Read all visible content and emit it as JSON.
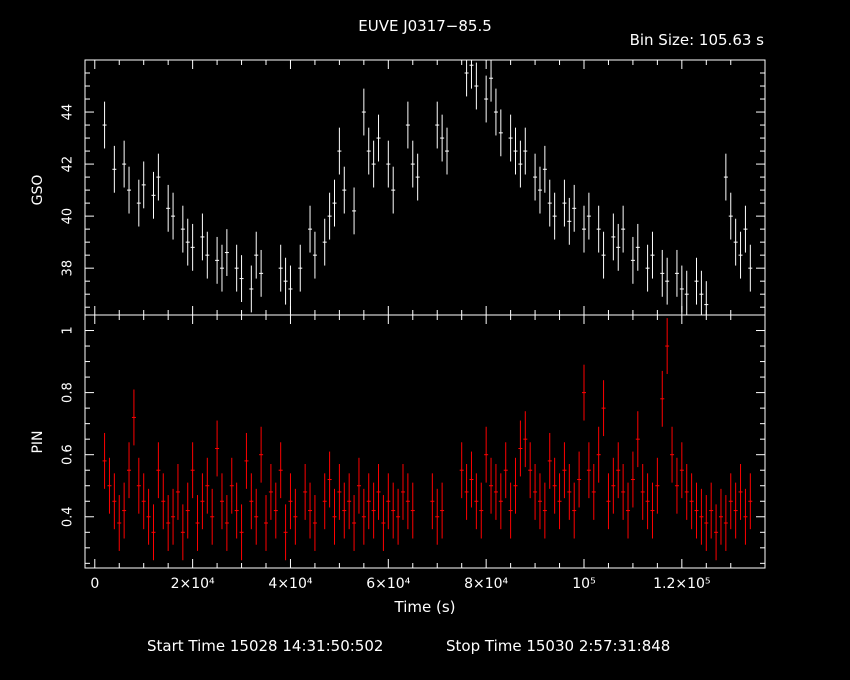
{
  "title": "EUVE J0317−85.5",
  "bin_size": "Bin Size: 105.63 s",
  "footer": {
    "start": "Start Time 15028 14:31:50:502",
    "stop": "Stop Time 15030  2:57:31:848"
  },
  "colors": {
    "background": "#000000",
    "axes": "#ffffff",
    "top_series": "#ffffff",
    "bottom_series": "#ff0000"
  },
  "chart_data": [
    {
      "type": "scatter",
      "ylabel": "GSO",
      "xlim": [
        -2000,
        137000
      ],
      "ylim": [
        36.2,
        46.0
      ],
      "yticks": [
        "38",
        "40",
        "42",
        "44"
      ],
      "series": [
        {
          "values_xy": [
            [
              2000,
              43.5
            ],
            [
              4000,
              41.8
            ],
            [
              6000,
              42.0
            ],
            [
              7000,
              41.0
            ],
            [
              9000,
              40.5
            ],
            [
              10000,
              41.2
            ],
            [
              12000,
              40.8
            ],
            [
              13000,
              41.5
            ],
            [
              15000,
              40.3
            ],
            [
              16000,
              40.0
            ],
            [
              18000,
              39.5
            ],
            [
              19000,
              39.0
            ],
            [
              20000,
              38.8
            ],
            [
              22000,
              39.2
            ],
            [
              23000,
              38.5
            ],
            [
              25000,
              38.3
            ],
            [
              26000,
              38.0
            ],
            [
              27000,
              38.6
            ],
            [
              29000,
              38.0
            ],
            [
              30000,
              37.6
            ],
            [
              32000,
              37.2
            ],
            [
              33000,
              38.5
            ],
            [
              34000,
              37.8
            ],
            [
              38000,
              38.0
            ],
            [
              39000,
              37.5
            ],
            [
              40000,
              37.2
            ],
            [
              42000,
              38.0
            ],
            [
              44000,
              39.5
            ],
            [
              45000,
              38.5
            ],
            [
              47000,
              39.0
            ],
            [
              48000,
              40.0
            ],
            [
              49000,
              40.5
            ],
            [
              50000,
              42.5
            ],
            [
              51000,
              41.0
            ],
            [
              53000,
              40.2
            ],
            [
              55000,
              44.0
            ],
            [
              56000,
              42.5
            ],
            [
              57000,
              42.0
            ],
            [
              58000,
              43.0
            ],
            [
              60000,
              42.0
            ],
            [
              61000,
              41.0
            ],
            [
              64000,
              43.5
            ],
            [
              65000,
              42.0
            ],
            [
              66000,
              41.5
            ],
            [
              70000,
              43.5
            ],
            [
              71000,
              43.0
            ],
            [
              72000,
              42.5
            ],
            [
              76000,
              45.5
            ],
            [
              77000,
              45.8
            ],
            [
              78000,
              45.0
            ],
            [
              80000,
              44.5
            ],
            [
              81000,
              45.3
            ],
            [
              82000,
              44.0
            ],
            [
              83000,
              43.2
            ],
            [
              85000,
              43.0
            ],
            [
              86000,
              42.5
            ],
            [
              87000,
              42.0
            ],
            [
              88000,
              42.5
            ],
            [
              90000,
              41.5
            ],
            [
              91000,
              41.0
            ],
            [
              92000,
              41.8
            ],
            [
              93000,
              40.5
            ],
            [
              94000,
              40.0
            ],
            [
              96000,
              40.5
            ],
            [
              97000,
              39.8
            ],
            [
              98000,
              40.3
            ],
            [
              100000,
              39.5
            ],
            [
              101000,
              40.0
            ],
            [
              103000,
              39.5
            ],
            [
              104000,
              38.5
            ],
            [
              106000,
              39.2
            ],
            [
              107000,
              38.8
            ],
            [
              108000,
              39.5
            ],
            [
              110000,
              38.3
            ],
            [
              111000,
              38.8
            ],
            [
              113000,
              38.0
            ],
            [
              114000,
              38.5
            ],
            [
              116000,
              37.8
            ],
            [
              117000,
              37.5
            ],
            [
              119000,
              37.8
            ],
            [
              120000,
              37.2
            ],
            [
              121000,
              37.0
            ],
            [
              123000,
              37.5
            ],
            [
              124000,
              37.0
            ],
            [
              125000,
              36.6
            ],
            [
              129000,
              41.5
            ],
            [
              130000,
              40.0
            ],
            [
              131000,
              39.0
            ],
            [
              132000,
              38.5
            ],
            [
              133000,
              39.5
            ],
            [
              134000,
              38.0
            ]
          ]
        }
      ]
    },
    {
      "type": "scatter",
      "ylabel": "PIN",
      "xlabel": "Time (s)",
      "xlim": [
        -2000,
        137000
      ],
      "ylim": [
        0.235,
        1.05
      ],
      "yticks": [
        "0.4",
        "0.6",
        "0.8",
        "1"
      ],
      "xticks": [
        "0",
        "2×10⁴",
        "4×10⁴",
        "6×10⁴",
        "8×10⁴",
        "10⁵",
        "1.2×10⁵"
      ],
      "xtick_values": [
        0,
        20000,
        40000,
        60000,
        80000,
        100000,
        120000
      ],
      "series": [
        {
          "values_xy": [
            [
              2000,
              0.58
            ],
            [
              3000,
              0.5
            ],
            [
              4000,
              0.45
            ],
            [
              5000,
              0.38
            ],
            [
              6000,
              0.42
            ],
            [
              7000,
              0.55
            ],
            [
              8000,
              0.72
            ],
            [
              9000,
              0.5
            ],
            [
              10000,
              0.45
            ],
            [
              11000,
              0.4
            ],
            [
              12000,
              0.35
            ],
            [
              13000,
              0.55
            ],
            [
              14000,
              0.45
            ],
            [
              15000,
              0.38
            ],
            [
              16000,
              0.4
            ],
            [
              17000,
              0.48
            ],
            [
              18000,
              0.35
            ],
            [
              19000,
              0.42
            ],
            [
              20000,
              0.55
            ],
            [
              21000,
              0.38
            ],
            [
              22000,
              0.45
            ],
            [
              23000,
              0.5
            ],
            [
              24000,
              0.4
            ],
            [
              25000,
              0.62
            ],
            [
              26000,
              0.45
            ],
            [
              27000,
              0.38
            ],
            [
              28000,
              0.5
            ],
            [
              29000,
              0.42
            ],
            [
              30000,
              0.35
            ],
            [
              31000,
              0.58
            ],
            [
              32000,
              0.45
            ],
            [
              33000,
              0.4
            ],
            [
              34000,
              0.6
            ],
            [
              35000,
              0.38
            ],
            [
              36000,
              0.48
            ],
            [
              37000,
              0.42
            ],
            [
              38000,
              0.55
            ],
            [
              39000,
              0.35
            ],
            [
              40000,
              0.45
            ],
            [
              41000,
              0.4
            ],
            [
              43000,
              0.48
            ],
            [
              44000,
              0.42
            ],
            [
              45000,
              0.38
            ],
            [
              47000,
              0.45
            ],
            [
              48000,
              0.52
            ],
            [
              49000,
              0.4
            ],
            [
              50000,
              0.48
            ],
            [
              51000,
              0.42
            ],
            [
              52000,
              0.45
            ],
            [
              53000,
              0.38
            ],
            [
              54000,
              0.5
            ],
            [
              55000,
              0.4
            ],
            [
              56000,
              0.45
            ],
            [
              57000,
              0.42
            ],
            [
              58000,
              0.48
            ],
            [
              59000,
              0.38
            ],
            [
              60000,
              0.45
            ],
            [
              61000,
              0.42
            ],
            [
              62000,
              0.4
            ],
            [
              63000,
              0.48
            ],
            [
              64000,
              0.45
            ],
            [
              65000,
              0.42
            ],
            [
              69000,
              0.45
            ],
            [
              70000,
              0.4
            ],
            [
              71000,
              0.42
            ],
            [
              75000,
              0.55
            ],
            [
              76000,
              0.48
            ],
            [
              77000,
              0.52
            ],
            [
              78000,
              0.45
            ],
            [
              79000,
              0.42
            ],
            [
              80000,
              0.6
            ],
            [
              81000,
              0.5
            ],
            [
              82000,
              0.48
            ],
            [
              83000,
              0.45
            ],
            [
              84000,
              0.55
            ],
            [
              85000,
              0.42
            ],
            [
              86000,
              0.5
            ],
            [
              87000,
              0.62
            ],
            [
              88000,
              0.65
            ],
            [
              89000,
              0.55
            ],
            [
              90000,
              0.48
            ],
            [
              91000,
              0.45
            ],
            [
              92000,
              0.42
            ],
            [
              93000,
              0.58
            ],
            [
              94000,
              0.5
            ],
            [
              95000,
              0.45
            ],
            [
              96000,
              0.55
            ],
            [
              97000,
              0.48
            ],
            [
              98000,
              0.42
            ],
            [
              99000,
              0.52
            ],
            [
              100000,
              0.8
            ],
            [
              101000,
              0.55
            ],
            [
              102000,
              0.48
            ],
            [
              103000,
              0.6
            ],
            [
              104000,
              0.75
            ],
            [
              105000,
              0.45
            ],
            [
              106000,
              0.5
            ],
            [
              107000,
              0.55
            ],
            [
              108000,
              0.48
            ],
            [
              109000,
              0.42
            ],
            [
              110000,
              0.52
            ],
            [
              111000,
              0.65
            ],
            [
              112000,
              0.48
            ],
            [
              113000,
              0.45
            ],
            [
              114000,
              0.42
            ],
            [
              115000,
              0.5
            ],
            [
              116000,
              0.78
            ],
            [
              117000,
              0.95
            ],
            [
              118000,
              0.6
            ],
            [
              119000,
              0.5
            ],
            [
              120000,
              0.55
            ],
            [
              121000,
              0.48
            ],
            [
              122000,
              0.45
            ],
            [
              123000,
              0.42
            ],
            [
              124000,
              0.4
            ],
            [
              125000,
              0.38
            ],
            [
              126000,
              0.42
            ],
            [
              127000,
              0.35
            ],
            [
              128000,
              0.4
            ],
            [
              129000,
              0.38
            ],
            [
              130000,
              0.45
            ],
            [
              131000,
              0.42
            ],
            [
              132000,
              0.48
            ],
            [
              133000,
              0.4
            ],
            [
              134000,
              0.45
            ]
          ]
        }
      ]
    }
  ]
}
